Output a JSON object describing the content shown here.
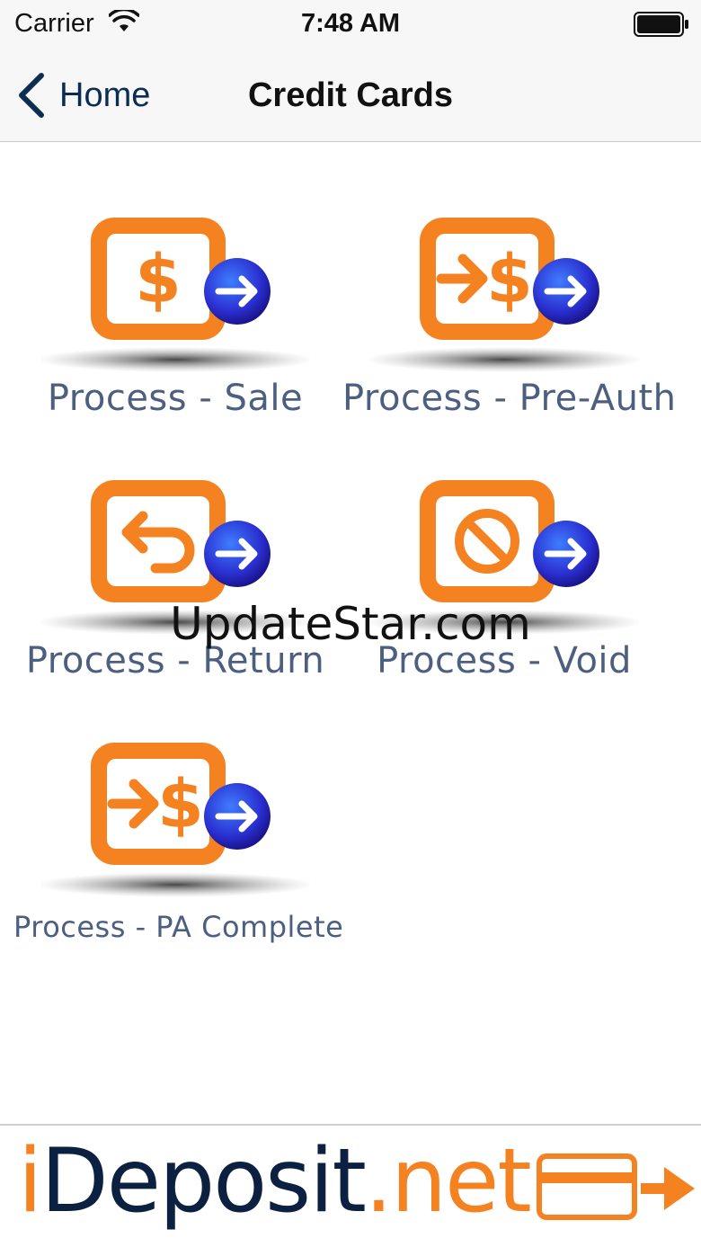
{
  "status_bar": {
    "carrier": "Carrier",
    "time": "7:48 AM"
  },
  "nav": {
    "back_label": "Home",
    "title": "Credit Cards"
  },
  "tiles": [
    {
      "label": "Process - Sale",
      "icon": "dollar-sign-icon"
    },
    {
      "label": "Process - Pre-Auth",
      "icon": "arrow-dollar-icon"
    },
    {
      "label": "Process - Return",
      "icon": "return-arrow-icon"
    },
    {
      "label": "Process - Void",
      "icon": "prohibited-icon"
    },
    {
      "label": "Process - PA Complete",
      "icon": "arrow-dollar-icon"
    }
  ],
  "watermark": "UpdateStar.com",
  "footer": {
    "brand_i": "i",
    "brand_deposit": "Deposit",
    "brand_net": ".net"
  },
  "colors": {
    "accent_orange": "#f58220",
    "label_blue": "#4c5f80",
    "brand_navy": "#0c2142",
    "arrow_blue": "#2f3fd6"
  }
}
